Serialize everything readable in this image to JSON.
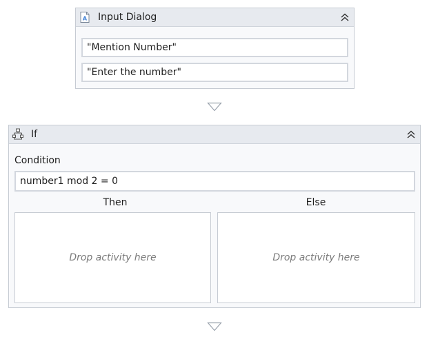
{
  "input_dialog": {
    "title": "Input Dialog",
    "dialog_title_value": "\"Mention Number\"",
    "label_value": "\"Enter the number\""
  },
  "if_activity": {
    "title": "If",
    "condition_label": "Condition",
    "condition_value": "number1 mod 2 = 0",
    "then_label": "Then",
    "else_label": "Else",
    "then_drop_hint": "Drop activity here",
    "else_drop_hint": "Drop activity here"
  },
  "icons": {
    "input_dialog": "input-dialog-icon",
    "if": "if-branch-icon",
    "collapse": "double-chevron-up-icon",
    "connector": "drop-triangle-icon"
  },
  "colors": {
    "header_bg": "#e7eaef",
    "border": "#c6cbd3",
    "icon_blue": "#3c7fd6"
  }
}
